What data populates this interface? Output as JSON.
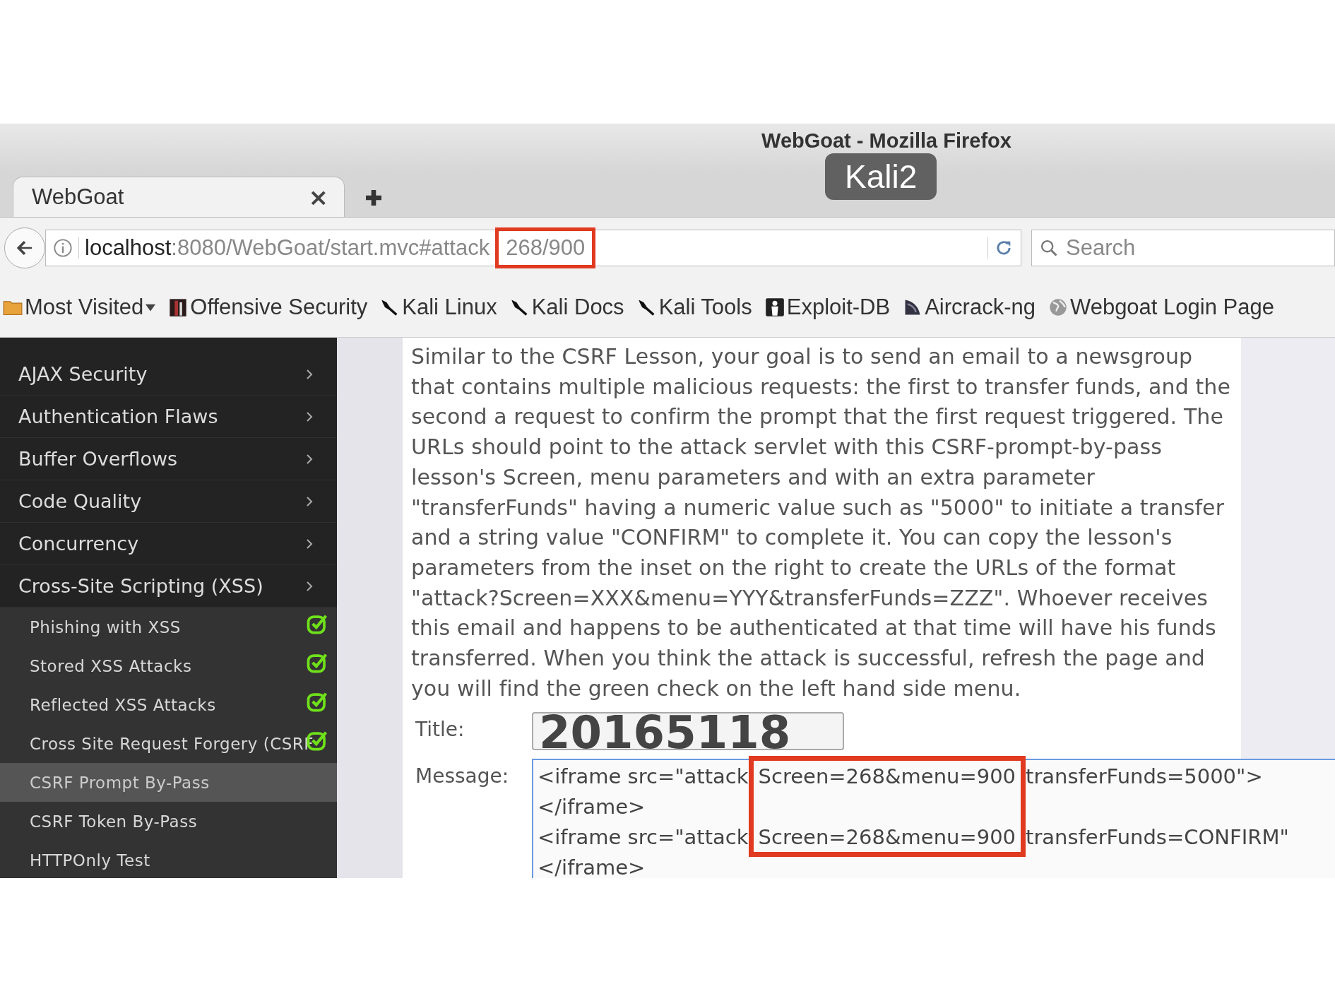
{
  "window": {
    "title": "WebGoat - Mozilla Firefox",
    "overlay_label": "Kali2"
  },
  "tabs": [
    {
      "label": "WebGoat",
      "selected": true,
      "close": "×"
    }
  ],
  "address": {
    "host": "localhost",
    "path": ":8080/WebGoat/start.mvc#attack",
    "highlighted": "268/900"
  },
  "search": {
    "placeholder": "Search"
  },
  "bookmarks": [
    {
      "label": "Most Visited",
      "has_menu": true
    },
    {
      "label": "Offensive Security"
    },
    {
      "label": "Kali Linux"
    },
    {
      "label": "Kali Docs"
    },
    {
      "label": "Kali Tools"
    },
    {
      "label": "Exploit-DB"
    },
    {
      "label": "Aircrack-ng"
    },
    {
      "label": "Webgoat Login Page"
    }
  ],
  "sidebar": {
    "categories": [
      {
        "label": "AJAX Security"
      },
      {
        "label": "Authentication Flaws"
      },
      {
        "label": "Buffer Overflows"
      },
      {
        "label": "Code Quality"
      },
      {
        "label": "Concurrency"
      },
      {
        "label": "Cross-Site Scripting (XSS)",
        "children": [
          {
            "label": "Phishing with XSS",
            "completed": true,
            "selected": false
          },
          {
            "label": "Stored XSS Attacks",
            "completed": true,
            "selected": false
          },
          {
            "label": "Reflected XSS Attacks",
            "completed": true,
            "selected": false
          },
          {
            "label": "Cross Site Request Forgery (CSRF",
            "completed": true,
            "selected": false
          },
          {
            "label": "CSRF Prompt By-Pass",
            "completed": false,
            "selected": true
          },
          {
            "label": "CSRF Token By-Pass",
            "completed": false,
            "selected": false
          },
          {
            "label": "HTTPOnly Test",
            "completed": false,
            "selected": false
          }
        ]
      }
    ]
  },
  "lesson": {
    "description": "Similar to the CSRF Lesson, your goal is to send an email to a newsgroup that contains multiple malicious requests: the first to transfer funds, and the second a request to confirm the prompt that the first request triggered. The URLs should point to the attack servlet with this CSRF-prompt-by-pass lesson's Screen, menu parameters and with an extra parameter \"transferFunds\" having a numeric value such as \"5000\" to initiate a transfer and a string value \"CONFIRM\" to complete it. You can copy the lesson's parameters from the inset on the right to create the URLs of the format \"attack?Screen=XXX&menu=YYY&transferFunds=ZZZ\". Whoever receives this email and happens to be authenticated at that time will have his funds transferred. When you think the attack is successful, refresh the page and you will find the green check on the left hand side menu.",
    "title_label": "Title:",
    "title_value": "20165118",
    "message_label": "Message:",
    "message_lines": [
      {
        "before": "<iframe src=\"attack",
        "highlighted": "Screen=268&menu=900",
        "after": "transferFunds=5000\">"
      },
      {
        "before": "</iframe>"
      },
      {
        "before": "<iframe src=\"attack",
        "highlighted": "Screen=268&menu=900",
        "after": "transferFunds=CONFIRM\""
      },
      {
        "before": "</iframe>"
      }
    ]
  }
}
